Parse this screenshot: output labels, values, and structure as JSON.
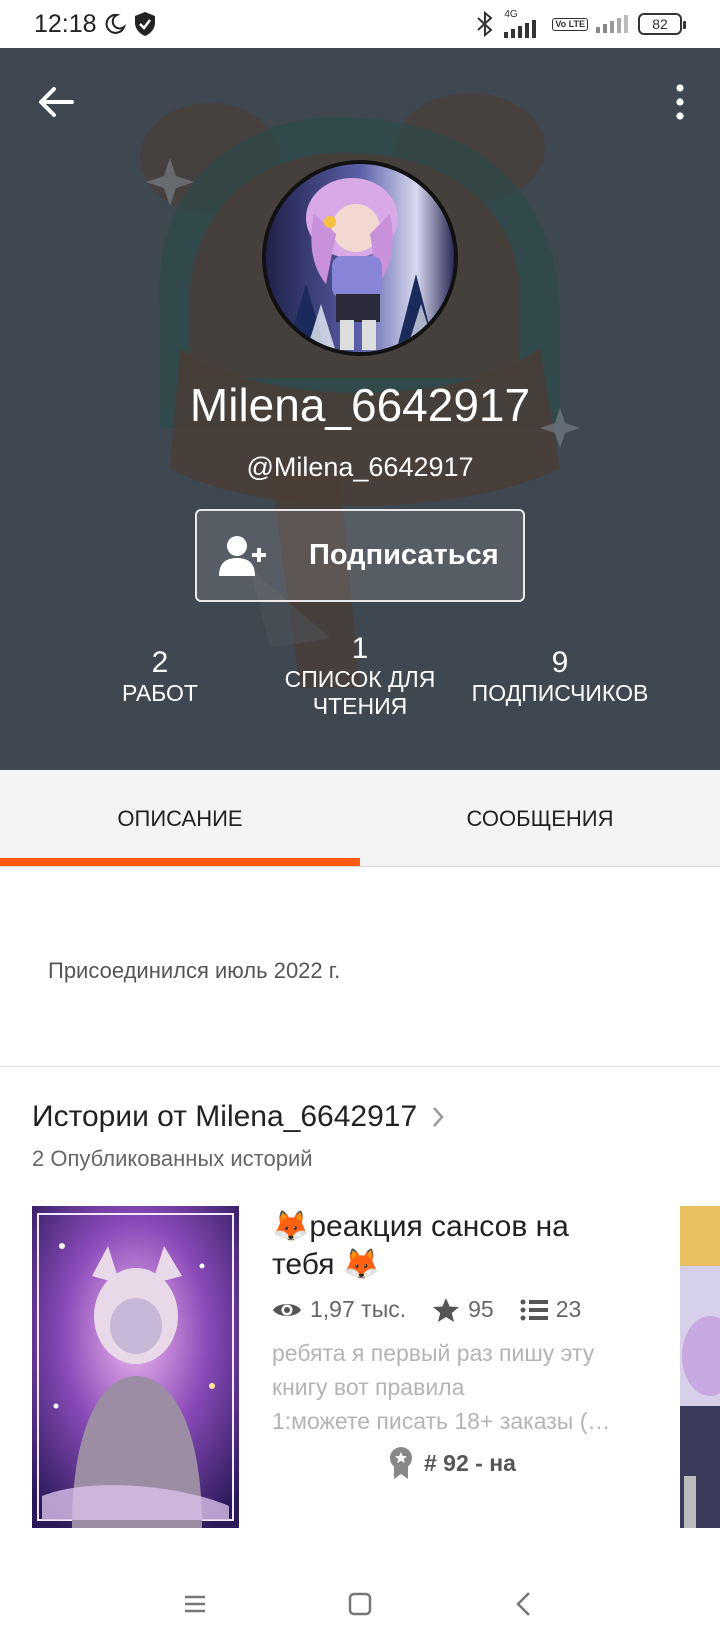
{
  "status_bar": {
    "time": "12:18",
    "network": "4G",
    "volte": "Vo LTE",
    "battery": "82"
  },
  "profile": {
    "display_name": "Milena_6642917",
    "handle": "@Milena_6642917",
    "follow_label": "Подписаться",
    "stats": [
      {
        "value": "2",
        "label": "РАБОТ"
      },
      {
        "value": "1",
        "label": "СПИСОК ДЛЯ ЧТЕНИЯ"
      },
      {
        "value": "9",
        "label": "ПОДПИСЧИКОВ"
      }
    ]
  },
  "tabs": [
    {
      "label": "ОПИСАНИЕ",
      "active": true
    },
    {
      "label": "СООБЩЕНИЯ",
      "active": false
    }
  ],
  "accent_color": "#ff5a10",
  "about": {
    "joined": "Присоединился июль 2022 г."
  },
  "stories": {
    "title": "Истории от Milena_6642917",
    "count": "2 Опубликованных историй",
    "items": [
      {
        "title": "🦊реакция сансов на тебя 🦊",
        "views": "1,97 тыс.",
        "votes": "95",
        "parts": "23",
        "desc_lines": [
          "ребята я первый раз пишу эту",
          "книгу вот правила",
          "1:можете писать 18+ заказы (…"
        ],
        "rank": "# 92 - на"
      }
    ]
  }
}
